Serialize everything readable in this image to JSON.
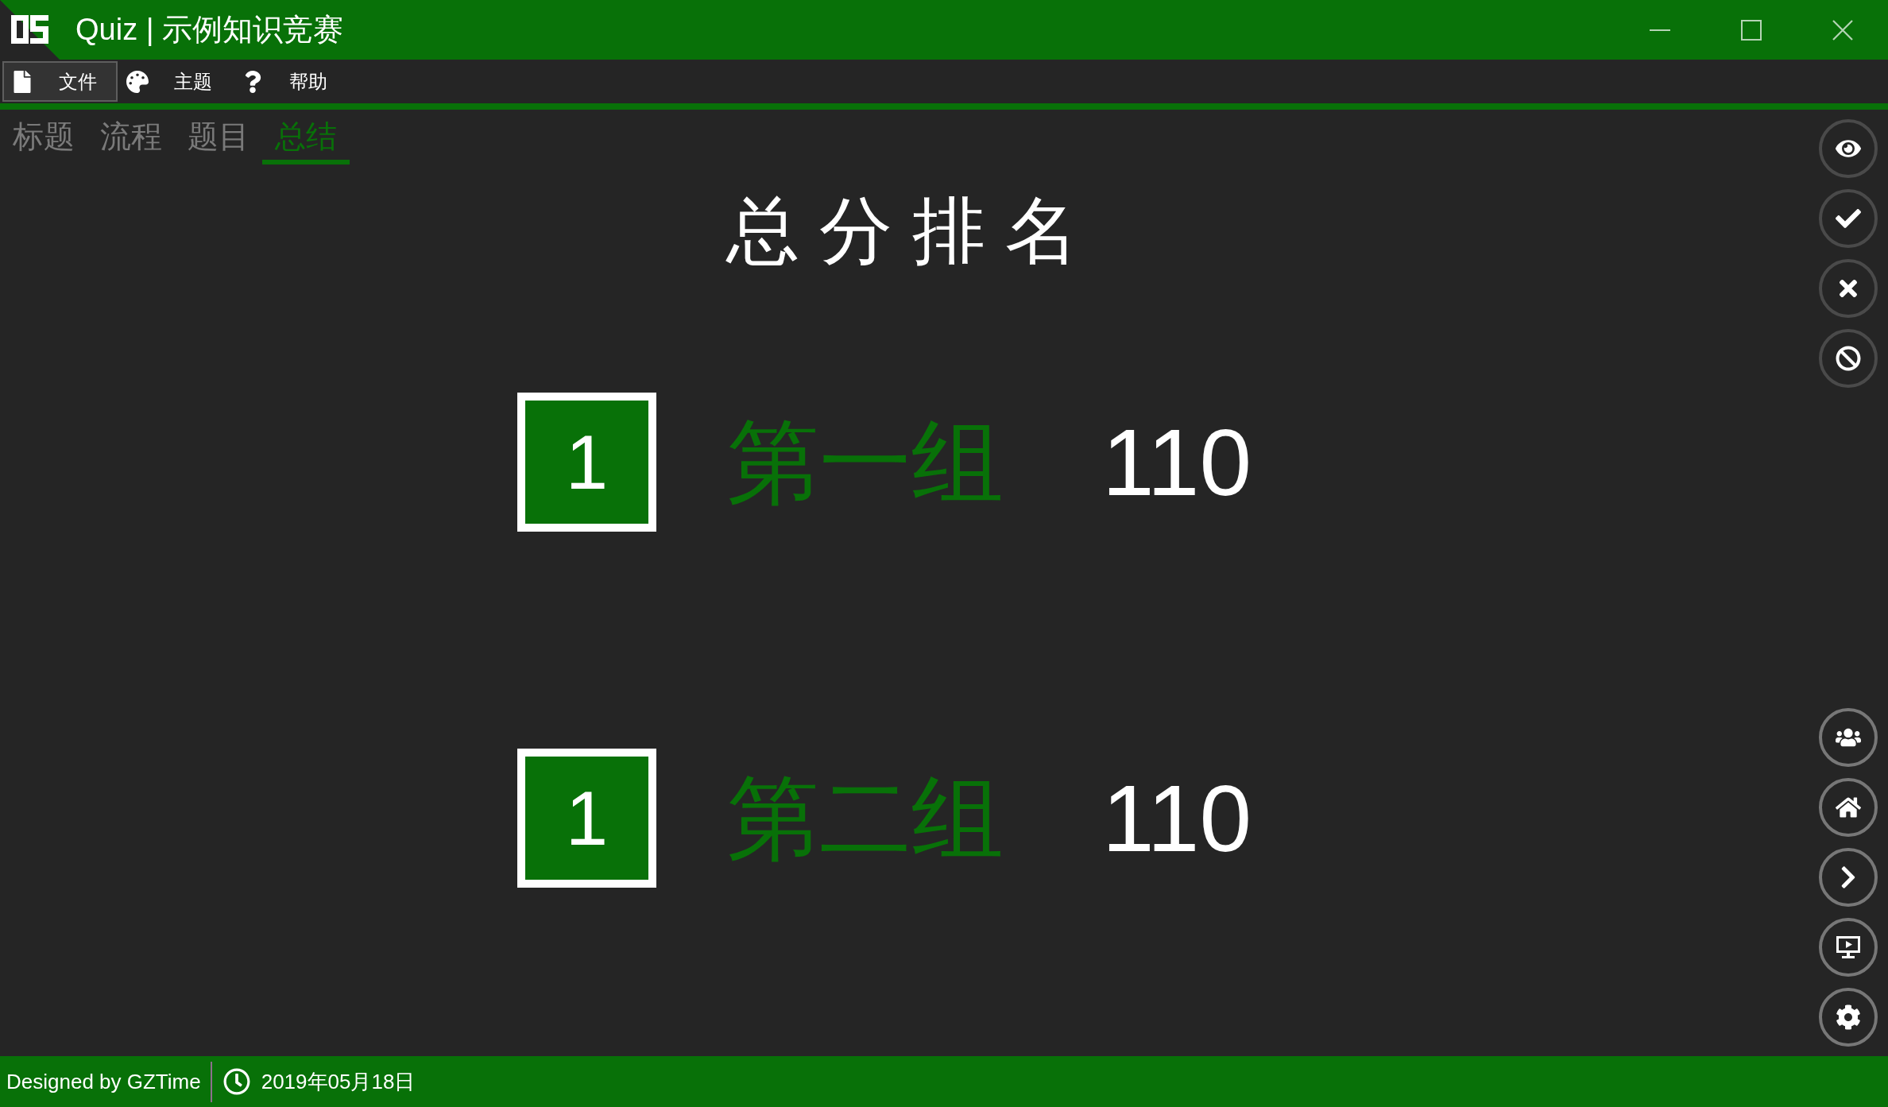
{
  "window": {
    "title": "Quiz | 示例知识竞赛"
  },
  "menu": [
    {
      "label": "文件",
      "highlighted": true
    },
    {
      "label": "主题",
      "highlighted": false
    },
    {
      "label": "帮助",
      "highlighted": false
    }
  ],
  "tabs": [
    {
      "label": "标题",
      "selected": false
    },
    {
      "label": "流程",
      "selected": false
    },
    {
      "label": "题目",
      "selected": false
    },
    {
      "label": "总结",
      "selected": true
    }
  ],
  "ranking": {
    "title": "总分排名",
    "rows": [
      {
        "rank": "1",
        "team": "第一组",
        "score": "110"
      },
      {
        "rank": "1",
        "team": "第二组",
        "score": "110"
      }
    ]
  },
  "status_bar": {
    "credit": "Designed by GZTime",
    "date": "2019年05月18日"
  }
}
